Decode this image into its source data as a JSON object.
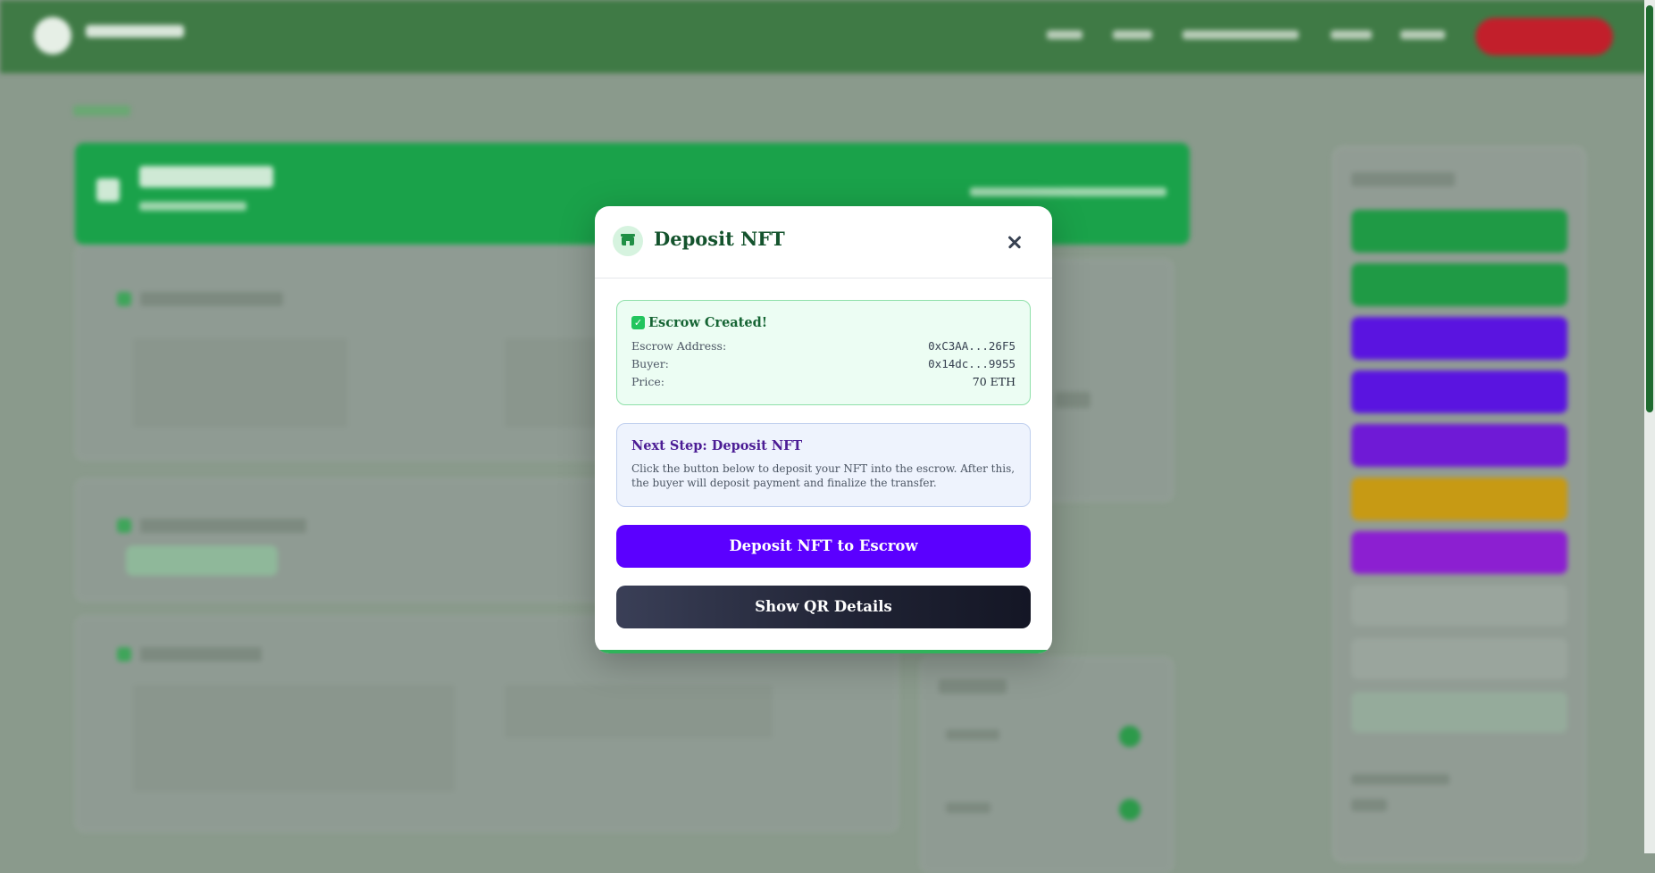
{
  "modal": {
    "title": "Deposit NFT",
    "icon": "store-icon",
    "close_icon": "close-icon",
    "escrow_created": {
      "title": "Escrow Created!",
      "check_icon": "check-mark-icon",
      "rows": [
        {
          "label": "Escrow Address:",
          "value": "0xC3AA...26F5"
        },
        {
          "label": "Buyer:",
          "value": "0x14dc...9955"
        },
        {
          "label": "Price:",
          "value": "70 ETH"
        }
      ]
    },
    "next_step": {
      "title": "Next Step: Deposit NFT",
      "body": "Click the button below to deposit your NFT into the escrow. After this, the buyer will deposit payment and finalize the transfer."
    },
    "deposit_button": "Deposit NFT to Escrow",
    "qr_button": "Show QR Details"
  },
  "colors": {
    "primary_purple": "#5b00ff",
    "success_green": "#22c55e",
    "title_green": "#14532d",
    "dark_button": "#1f2233"
  }
}
